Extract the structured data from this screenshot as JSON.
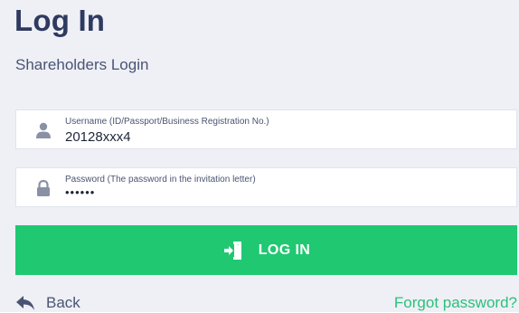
{
  "header": {
    "title": "Log In",
    "subtitle": "Shareholders Login"
  },
  "form": {
    "username": {
      "label": "Username (ID/Passport/Business Registration No.)",
      "value": "20128xxx4",
      "icon": "user-icon"
    },
    "password": {
      "label": "Password (The password in the invitation letter)",
      "value": "••••••",
      "icon": "lock-icon"
    },
    "login_button": {
      "label": "LOG IN",
      "icon": "login-icon"
    }
  },
  "footer": {
    "back_label": "Back",
    "back_icon": "back-arrow-icon",
    "forgot_label": "Forgot password?"
  },
  "colors": {
    "page_background": "#eef0f6",
    "heading": "#2f3a60",
    "button": "#20c872",
    "link": "#2cc07a",
    "field_background": "#ffffff"
  }
}
